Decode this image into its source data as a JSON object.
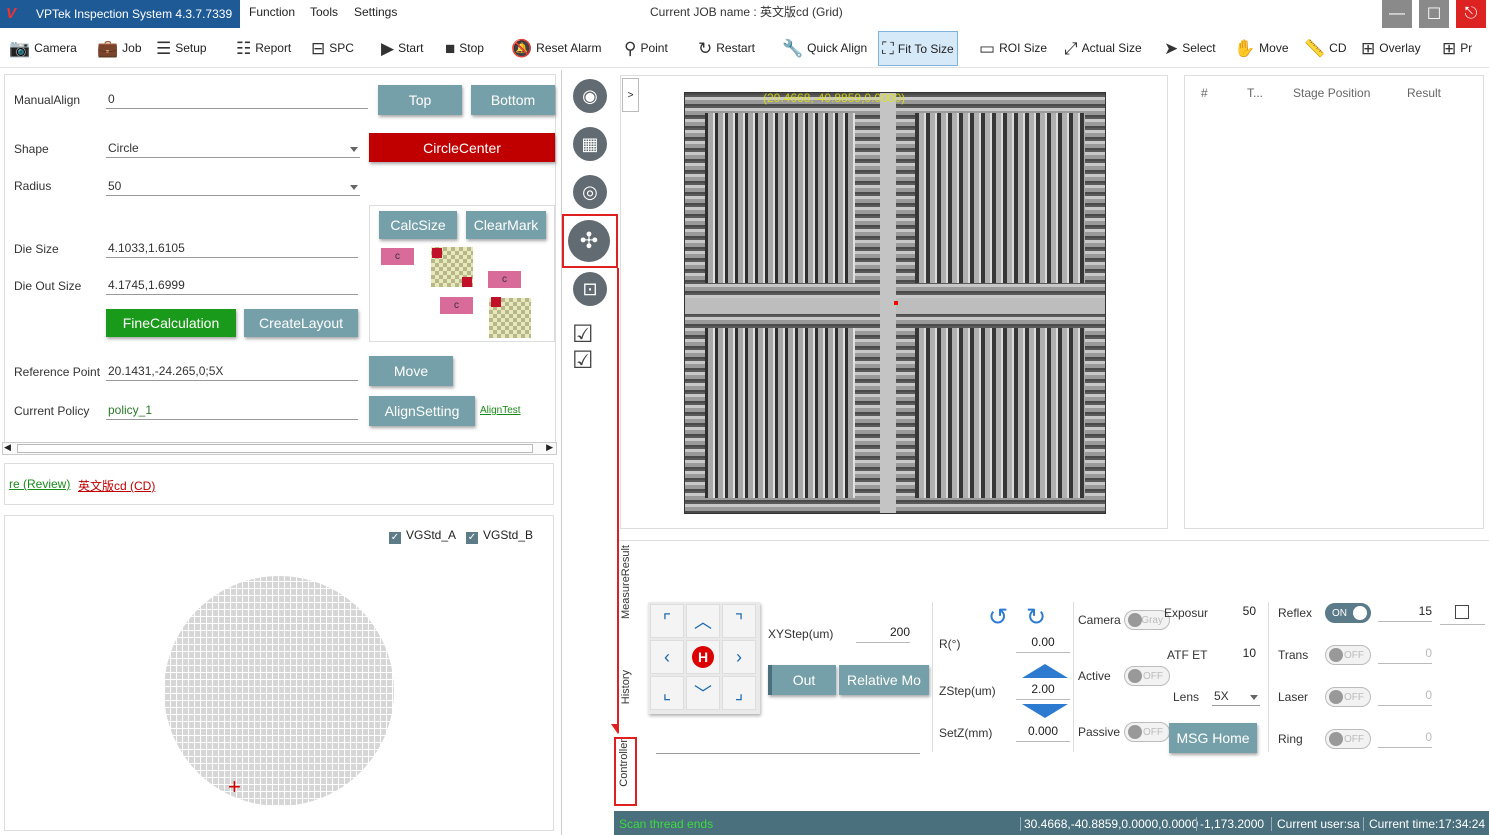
{
  "app": {
    "title": "VPTek Inspection System 4.3.7.7339",
    "job_label": "Current JOB name : 英文版cd (Grid)"
  },
  "menu": [
    "Function",
    "Tools",
    "Settings"
  ],
  "toolbar": {
    "camera": "Camera",
    "job": "Job",
    "setup": "Setup",
    "report": "Report",
    "spc": "SPC",
    "start": "Start",
    "stop": "Stop",
    "reset_alarm": "Reset Alarm",
    "point": "Point",
    "restart": "Restart",
    "quick_align": "Quick Align",
    "fit_to_size": "Fit To Size",
    "roi_size": "ROI Size",
    "actual_size": "Actual Size",
    "select": "Select",
    "move": "Move",
    "cd": "CD",
    "overlay": "Overlay",
    "pr": "Pr"
  },
  "align": {
    "manual_align_label": "ManualAlign",
    "manual_align_value": "0",
    "top": "Top",
    "bottom": "Bottom",
    "shape_label": "Shape",
    "shape_value": "Circle",
    "circle_center": "CircleCenter",
    "radius_label": "Radius",
    "radius_value": "50",
    "calc_size": "CalcSize",
    "clear_mark": "ClearMark",
    "mark_c": "c",
    "die_size_label": "Die Size",
    "die_size_value": "4.1033,1.6105",
    "die_out_label": "Die Out Size",
    "die_out_value": "4.1745,1.6999",
    "fine_calc": "FineCalculation",
    "create_layout": "CreateLayout",
    "ref_point_label": "Reference Point",
    "ref_point_value": "20.1431,-24.265,0;5X",
    "move": "Move",
    "policy_label": "Current Policy",
    "policy_value": "policy_1",
    "align_setting": "AlignSetting",
    "align_test": "AlignTest"
  },
  "links": {
    "review": "re (Review)",
    "cd": "英文版cd (CD)"
  },
  "wafer": {
    "vg_a": "VGStd_A",
    "vg_b": "VGStd_B"
  },
  "results": {
    "cols": [
      "#",
      "T...",
      "Stage Position",
      "Result"
    ]
  },
  "image_overlay": "(20.4668,-40.8859,0.0000)",
  "vtabs": {
    "measure": "MeasureResult",
    "history": "History",
    "controller": "Controller"
  },
  "ctrl": {
    "xystep_label": "XYStep(um)",
    "xystep_value": "200",
    "out": "Out",
    "relative": "Relative Mo",
    "r_label": "R(°)",
    "r_value": "0.00",
    "zstep_label": "ZStep(um)",
    "zstep_value": "2.00",
    "setz_label": "SetZ(mm)",
    "setz_value": "0.000",
    "camera_label": "Camera",
    "camera_toggle": "Gray",
    "exposure_label": "Exposur",
    "exposure_value": "50",
    "active_label": "Active",
    "passive_label": "Passive",
    "off": "OFF",
    "on": "ON",
    "atf_label": "ATF ET",
    "atf_value": "10",
    "lens_label": "Lens",
    "lens_value": "5X",
    "msg_home": "MSG Home",
    "reflex_label": "Reflex",
    "reflex_value": "15",
    "trans_label": "Trans",
    "trans_value": "0",
    "laser_label": "Laser",
    "laser_value": "0",
    "ring_label": "Ring",
    "ring_value": "0"
  },
  "status": {
    "left": "Scan thread ends",
    "pos": "30.4668,-40.8859,0.0000,0.0000",
    "z": "-1,173.2000",
    "user": "Current user:sa",
    "time": "Current time:17:34:24"
  },
  "colors": {
    "accent": "#1e5a96",
    "status": "#4a6f7d",
    "red": "#c00000",
    "green": "#1a9a1a",
    "highlight": "#e02020"
  }
}
